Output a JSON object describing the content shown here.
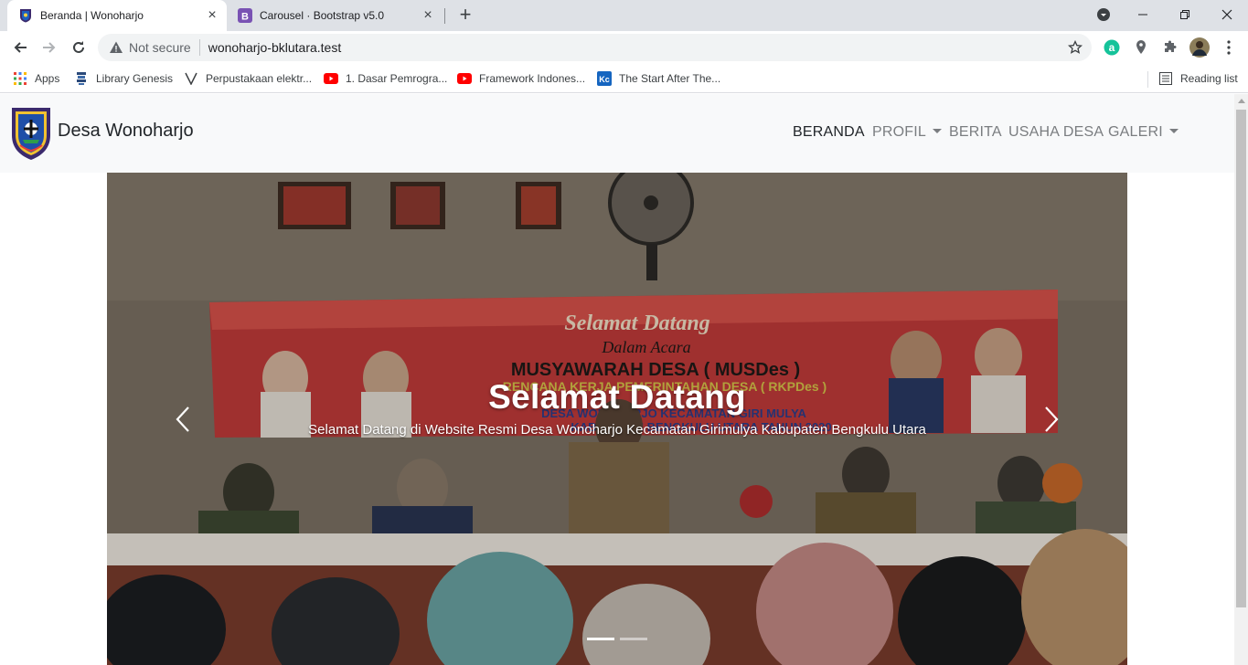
{
  "browser": {
    "tabs": [
      {
        "title": "Beranda | Wonoharjo",
        "active": true
      },
      {
        "title": "Carousel · Bootstrap v5.0",
        "active": false
      }
    ],
    "security_label": "Not secure",
    "url": "wonoharjo-bklutara.test",
    "bookmarks": [
      {
        "label": "Apps",
        "icon": "apps-grid-icon"
      },
      {
        "label": "Library Genesis",
        "icon": "library-genesis-icon"
      },
      {
        "label": "Perpustakaan elektr...",
        "icon": "v-logo-icon"
      },
      {
        "label": "1. Dasar Pemrogra...",
        "icon": "youtube-icon"
      },
      {
        "label": "Framework Indones...",
        "icon": "youtube-icon"
      },
      {
        "label": "The Start After The...",
        "icon": "kc-icon"
      }
    ],
    "reading_list": "Reading list",
    "colors": {
      "tabstrip": "#dee1e6",
      "youtube": "#ff0000",
      "bootstrap": "#7952b3"
    }
  },
  "site": {
    "brand": "Desa Wonoharjo",
    "nav": [
      {
        "label": "BERANDA",
        "active": true,
        "dropdown": false
      },
      {
        "label": "PROFIL",
        "active": false,
        "dropdown": true
      },
      {
        "label": "BERITA",
        "active": false,
        "dropdown": false
      },
      {
        "label": "USAHA DESA",
        "active": false,
        "dropdown": false
      },
      {
        "label": "GALERI",
        "active": false,
        "dropdown": true
      }
    ],
    "carousel": {
      "heading": "Selamat Datang",
      "text": "Selamat Datang di Website Resmi Desa Wonoharjo Kecamatan Girimulya Kabupaten Bengkulu Utara",
      "active_slide": 1,
      "slide_count": 2,
      "banner_lines": [
        "Selamat Datang",
        "Dalam Acara",
        "MUSYAWARAH DESA ( MUSDes )",
        "RENCANA KERJA PEMERINTAHAN DESA ( RKPDes )",
        "DESA WONOHARJO KECAMATAN GIRI MULYA",
        "KABUPATEN BENGKULU UTARA TAHUN 2020"
      ]
    }
  }
}
